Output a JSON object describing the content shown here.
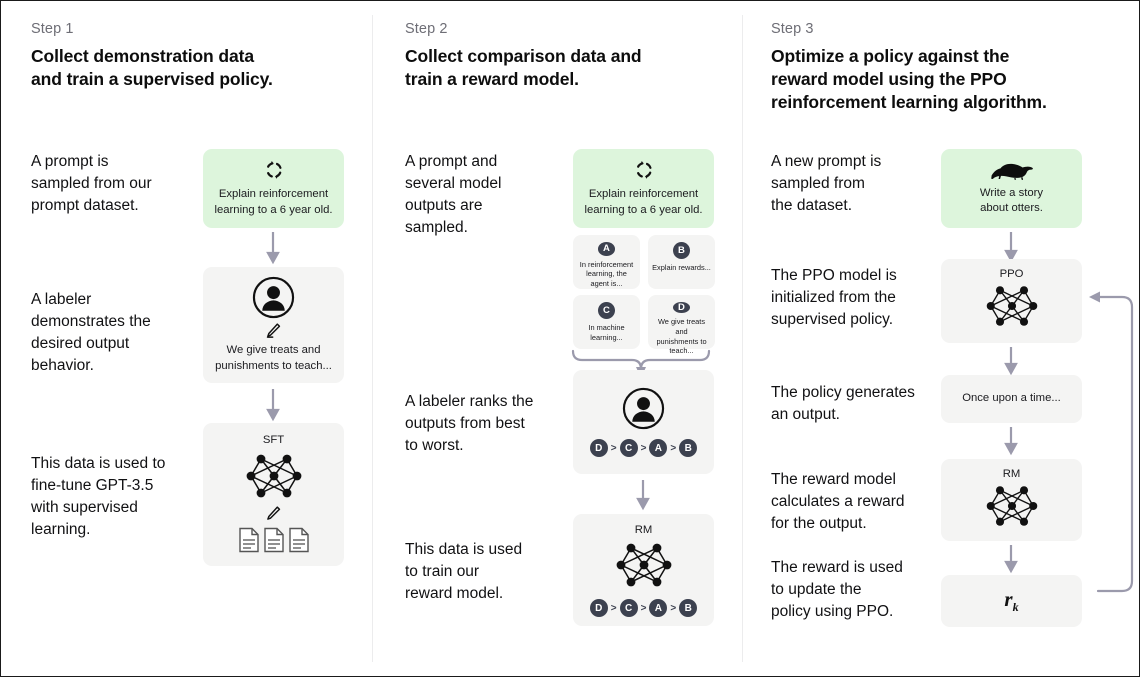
{
  "diagram": {
    "title": "RLHF three-step training diagram",
    "accent_green": "#ddf5dc",
    "card_gray": "#f4f4f3",
    "arrow_color": "#9b9aac",
    "badge_color": "#3c414f"
  },
  "steps": [
    {
      "label": "Step 1",
      "title": "Collect demonstration data\nand train a supervised policy.",
      "captions": [
        "A prompt is\nsampled from our\nprompt dataset.",
        "A labeler\ndemonstrates the\ndesired output\nbehavior.",
        "This data is used to\nfine-tune GPT-3.5\nwith supervised\nlearning."
      ],
      "cards": [
        {
          "icon": "refresh-circle-icon",
          "text": "Explain reinforcement\nlearning to a 6 year old."
        },
        {
          "icon": "labeler-person-icon",
          "text": "We give treats and\npunishments to teach..."
        },
        {
          "icon": "neural-network-icon",
          "title": "SFT",
          "docs": 3
        }
      ]
    },
    {
      "label": "Step 2",
      "title": "Collect comparison data and\ntrain a reward model.",
      "captions": [
        "A prompt and\nseveral model\noutputs are\nsampled.",
        "A labeler ranks the\noutputs from best\nto worst.",
        "This data is used\nto train our\nreward model."
      ],
      "prompt_card": {
        "icon": "refresh-circle-icon",
        "text": "Explain reinforcement\nlearning to a 6 year old."
      },
      "options": [
        {
          "badge": "A",
          "text": "In reinforcement\nlearning, the\nagent is..."
        },
        {
          "badge": "B",
          "text": "Explain rewards..."
        },
        {
          "badge": "C",
          "text": "In machine\nlearning..."
        },
        {
          "badge": "D",
          "text": "We give treats and\npunishments to\nteach..."
        }
      ],
      "ranking": [
        "D",
        "C",
        "A",
        "B"
      ],
      "ranking_separator": ">",
      "reward_card": {
        "icon": "neural-network-icon",
        "title": "RM"
      }
    },
    {
      "label": "Step 3",
      "title": "Optimize a policy against the\nreward model using the PPO\nreinforcement learning algorithm.",
      "captions": [
        "A new prompt is\nsampled from\nthe dataset.",
        "The PPO model is\ninitialized from the\nsupervised policy.",
        "The policy generates\nan output.",
        "The reward model\ncalculates a reward\nfor the output.",
        "The reward is used\nto update the\npolicy using PPO."
      ],
      "cards": [
        {
          "icon": "otter-icon",
          "text": "Write a story\nabout otters."
        },
        {
          "icon": "neural-network-icon",
          "title": "PPO"
        },
        {
          "icon": "text-output",
          "text": "Once upon a time..."
        },
        {
          "icon": "neural-network-icon",
          "title": "RM"
        },
        {
          "icon": "reward-value",
          "symbol": "r",
          "subscript": "k"
        }
      ]
    }
  ]
}
